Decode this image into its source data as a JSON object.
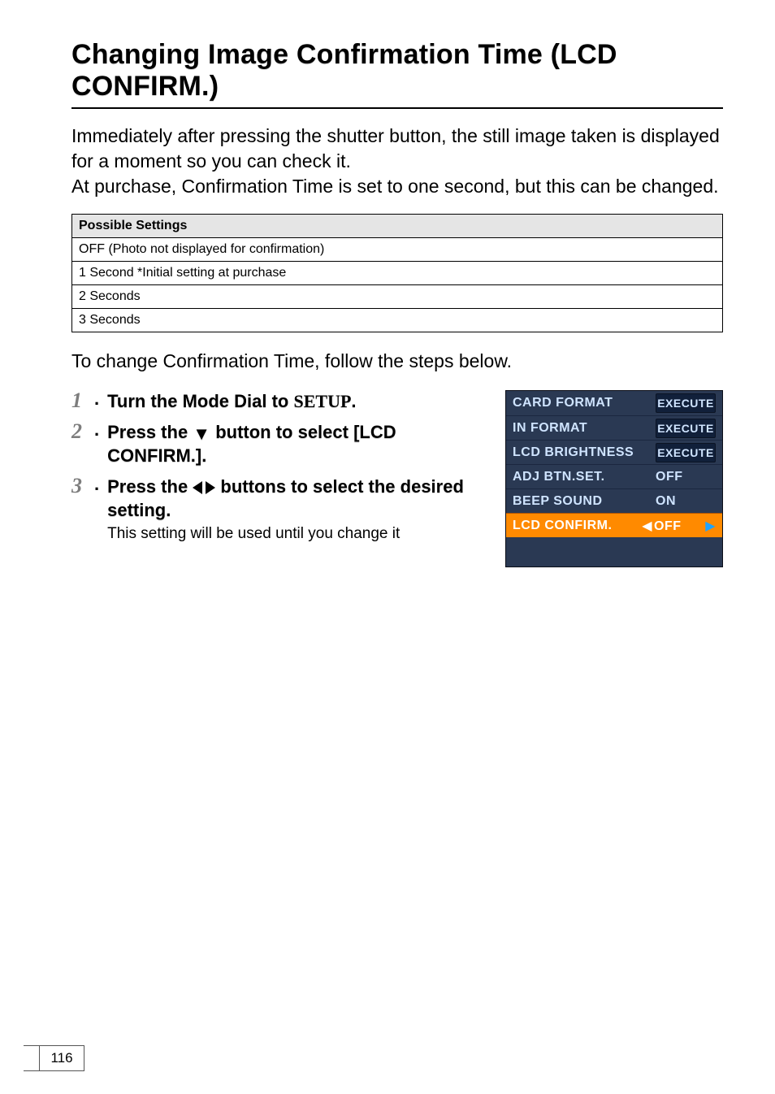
{
  "title": "Changing Image Confirmation Time (LCD CONFIRM.)",
  "intro": "Immediately after pressing the shutter button, the still image taken is displayed for a moment so you can check it.\nAt purchase, Confirmation Time is set to one second, but this can be changed.",
  "settings_header": "Possible Settings",
  "settings_rows": [
    "OFF (Photo not displayed for confirmation)",
    "1 Second *Initial setting at purchase",
    "2 Seconds",
    "3 Seconds"
  ],
  "follow": "To change Confirmation Time, follow the steps below.",
  "steps": [
    {
      "num": "1",
      "lead_pre": "Turn the Mode Dial to ",
      "lead_setup": "SETUP",
      "lead_post": ".",
      "sub": ""
    },
    {
      "num": "2",
      "lead_pre": "Press the ",
      "lead_icon": "down",
      "lead_post": " button to select [LCD CONFIRM.].",
      "sub": ""
    },
    {
      "num": "3",
      "lead_pre": "Press the ",
      "lead_icon": "lr",
      "lead_post": " buttons to select the desired setting.",
      "sub": "This setting will be used until you change it"
    }
  ],
  "menu": [
    {
      "label": "CARD FORMAT",
      "value": "EXECUTE",
      "exec": true
    },
    {
      "label": "IN FORMAT",
      "value": "EXECUTE",
      "exec": true
    },
    {
      "label": "LCD BRIGHTNESS",
      "value": "EXECUTE",
      "exec": true
    },
    {
      "label": "ADJ BTN.SET.",
      "value": "OFF",
      "exec": false
    },
    {
      "label": "BEEP SOUND",
      "value": "ON",
      "exec": false
    },
    {
      "label": "LCD CONFIRM.",
      "value": "OFF",
      "exec": false,
      "selected": true
    }
  ],
  "page_number": "116"
}
